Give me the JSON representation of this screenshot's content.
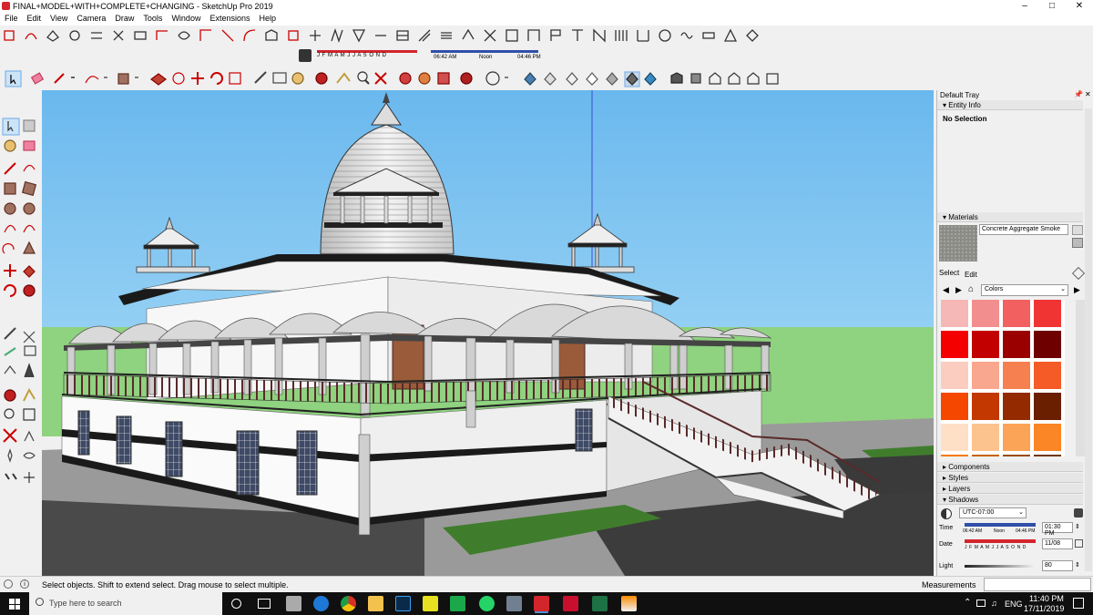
{
  "window": {
    "title": "FINAL+MODEL+WITH+COMPLETE+CHANGING - SketchUp Pro 2019",
    "minimize": "–",
    "maximize": "□",
    "close": "✕"
  },
  "menu": [
    "File",
    "Edit",
    "View",
    "Camera",
    "Draw",
    "Tools",
    "Window",
    "Extensions",
    "Help"
  ],
  "shadow_toolbar": {
    "months": "J F M A M J J A S O N D",
    "start_time": "06:42 AM",
    "noon": "Noon",
    "end_time": "04:46 PM"
  },
  "tray": {
    "title": "Default Tray",
    "entity_info": {
      "header": "Entity Info",
      "selection": "No Selection"
    },
    "materials": {
      "header": "Materials",
      "material_name": "Concrete Aggregate Smoke",
      "tab_select": "Select",
      "tab_edit": "Edit",
      "library": "Colors",
      "swatches": [
        "#f6b7b7",
        "#f38e8e",
        "#f26060",
        "#f03434",
        "#f50000",
        "#c20000",
        "#9a0000",
        "#6e0000",
        "#fbcdc0",
        "#f9a78e",
        "#f6804f",
        "#f45b26",
        "#f54700",
        "#c23800",
        "#942b00",
        "#6a1f00",
        "#fde0c6",
        "#fcc38f",
        "#fba356",
        "#fa8626",
        "#f57a00",
        "#c86300",
        "#994c00",
        "#6e3600"
      ]
    },
    "collapsed_panels": [
      "Components",
      "Styles",
      "Layers"
    ],
    "shadows": {
      "header": "Shadows",
      "timezone": "UTC-07:00",
      "time_label": "Time",
      "time_start": "06:42 AM",
      "time_noon": "Noon",
      "time_end": "04:46 PM",
      "time_value": "01:30 PM",
      "date_label": "Date",
      "date_months": "J F M A M J J A S O N D",
      "date_value": "11/08",
      "light_label": "Light",
      "light_value": "80"
    }
  },
  "status": {
    "hint": "Select objects. Shift to extend select. Drag mouse to select multiple.",
    "measurements_label": "Measurements"
  },
  "taskbar": {
    "search_placeholder": "Type here to search",
    "language": "ENG",
    "time": "11:40 PM",
    "date": "17/11/2019"
  },
  "colors": {
    "sky": "#7cc4f0",
    "ground": "#a3a3a3",
    "grass": "#3f7d2c",
    "accent_red": "#d3252c"
  },
  "icons": [
    "select-icon",
    "eraser-icon",
    "pencil-icon",
    "arc-icon",
    "paint-bucket-icon",
    "push-pull-icon",
    "move-icon",
    "rotate-icon",
    "scale-icon",
    "tape-measure-icon",
    "text-icon",
    "orbit-icon",
    "pan-icon",
    "zoom-icon",
    "zoom-extents-icon",
    "search-icon",
    "windows-icon"
  ]
}
